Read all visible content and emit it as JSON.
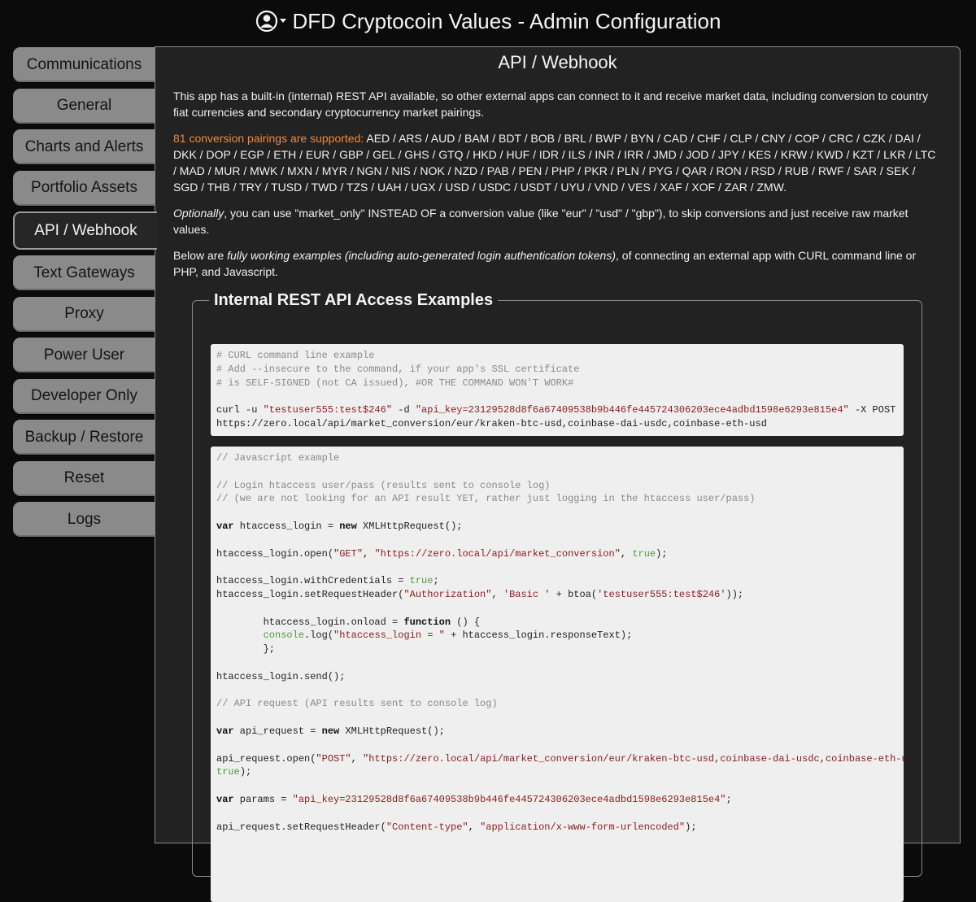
{
  "header": {
    "title": "DFD Cryptocoin Values - Admin Configuration",
    "user_icon": "user-circle-icon"
  },
  "sidebar": {
    "items": [
      {
        "label": "Communications"
      },
      {
        "label": "General"
      },
      {
        "label": "Charts and Alerts"
      },
      {
        "label": "Portfolio Assets"
      },
      {
        "label": "API / Webhook",
        "active": true
      },
      {
        "label": "Text Gateways"
      },
      {
        "label": "Proxy"
      },
      {
        "label": "Power User"
      },
      {
        "label": "Developer Only"
      },
      {
        "label": "Backup / Restore"
      },
      {
        "label": "Reset"
      },
      {
        "label": "Logs"
      }
    ]
  },
  "main": {
    "title": "API / Webhook",
    "intro": "This app has a built-in (internal) REST API available, so other external apps can connect to it and receive market data, including conversion to country fiat currencies and secondary cryptocurrency market pairings.",
    "pairings_label": "81 conversion pairings are supported:",
    "pairings_list": " AED / ARS / AUD / BAM / BDT / BOB / BRL / BWP / BYN / CAD / CHF / CLP / CNY / COP / CRC / CZK / DAI / DKK / DOP / EGP / ETH / EUR / GBP / GEL / GHS / GTQ / HKD / HUF / IDR / ILS / INR / IRR / JMD / JOD / JPY / KES / KRW / KWD / KZT / LKR / LTC / MAD / MUR / MWK / MXN / MYR / NGN / NIS / NOK / NZD / PAB / PEN / PHP / PKR / PLN / PYG / QAR / RON / RSD / RUB / RWF / SAR / SEK / SGD / THB / TRY / TUSD / TWD / TZS / UAH / UGX / USD / USDC / USDT / UYU / VND / VES / XAF / XOF / ZAR / ZMW.",
    "optional_em": "Optionally",
    "optional_rest": ", you can use \"market_only\" INSTEAD OF a conversion value (like \"eur\" / \"usd\" / \"gbp\"), to skip conversions and just receive raw market values.",
    "below_a": "Below are ",
    "below_em": "fully working examples (including auto-generated login authentication tokens)",
    "below_b": ", of connecting an external app with CURL command line or PHP, and Javascript.",
    "examples_legend": "Internal REST API Access Examples",
    "curl": {
      "c1": "# CURL command line example",
      "c2": "# Add --insecure to the command, if your app's SSL certificate",
      "c3": "# is SELF-SIGNED (not CA issued), #OR THE COMMAND WON'T WORK#",
      "cmd_a": "curl -u ",
      "user": "\"testuser555:test$246\"",
      "cmd_b": " -d ",
      "key": "\"api_key=23129528d8f6a67409538b9b446fe445724306203ece4adbd1598e6293e815e4\"",
      "cmd_c": " -X POST",
      "url": "https://zero.local/api/market_conversion/eur/kraken-btc-usd,coinbase-dai-usdc,coinbase-eth-usd"
    },
    "js": {
      "c1": "// Javascript example",
      "c2": "// Login htaccess user/pass (results sent to console log)",
      "c3": "// (we are not looking for an API result YET, rather just logging in the htaccess user/pass)",
      "var": "var",
      "new": "new",
      "l1b": " htaccess_login = ",
      "l1d": " XMLHttpRequest();",
      "l2a": "htaccess_login.open(",
      "get": "\"GET\"",
      "sep": ", ",
      "url1": "\"https://zero.local/api/market_conversion\"",
      "true": "true",
      "close": ");",
      "l3a": "htaccess_login.withCredentials = ",
      "semi": ";",
      "l4a": "htaccess_login.setRequestHeader(",
      "auth": "\"Authorization\"",
      "basic": "'Basic '",
      "l4b": " + btoa(",
      "cred": "'testuser555:test$246'",
      "l4c": "));",
      "l5a": "        htaccess_login.onload = ",
      "function": "function",
      "l5b": " () {",
      "l6a": "        ",
      "console": "console",
      "l6b": ".log(",
      "logstr": "\"htaccess_login = \"",
      "l6c": " + htaccess_login.responseText);",
      "l7": "        };",
      "l8": "htaccess_login.send();",
      "c4": "// API request (API results sent to console log)",
      "l9b": " api_request = ",
      "l9d": " XMLHttpRequest();",
      "l10a": "api_request.open(",
      "post": "\"POST\"",
      "url2": "\"https://zero.local/api/market_conversion/eur/kraken-btc-usd,coinbase-dai-usdc,coinbase-eth-usd\"",
      "l10b": ",",
      "l11b": " params = ",
      "params": "\"api_key=23129528d8f6a67409538b9b446fe445724306203ece4adbd1598e6293e815e4\"",
      "l12a": "api_request.setRequestHeader(",
      "ctype": "\"Content-type\"",
      "form": "\"application/x-www-form-urlencoded\""
    }
  }
}
